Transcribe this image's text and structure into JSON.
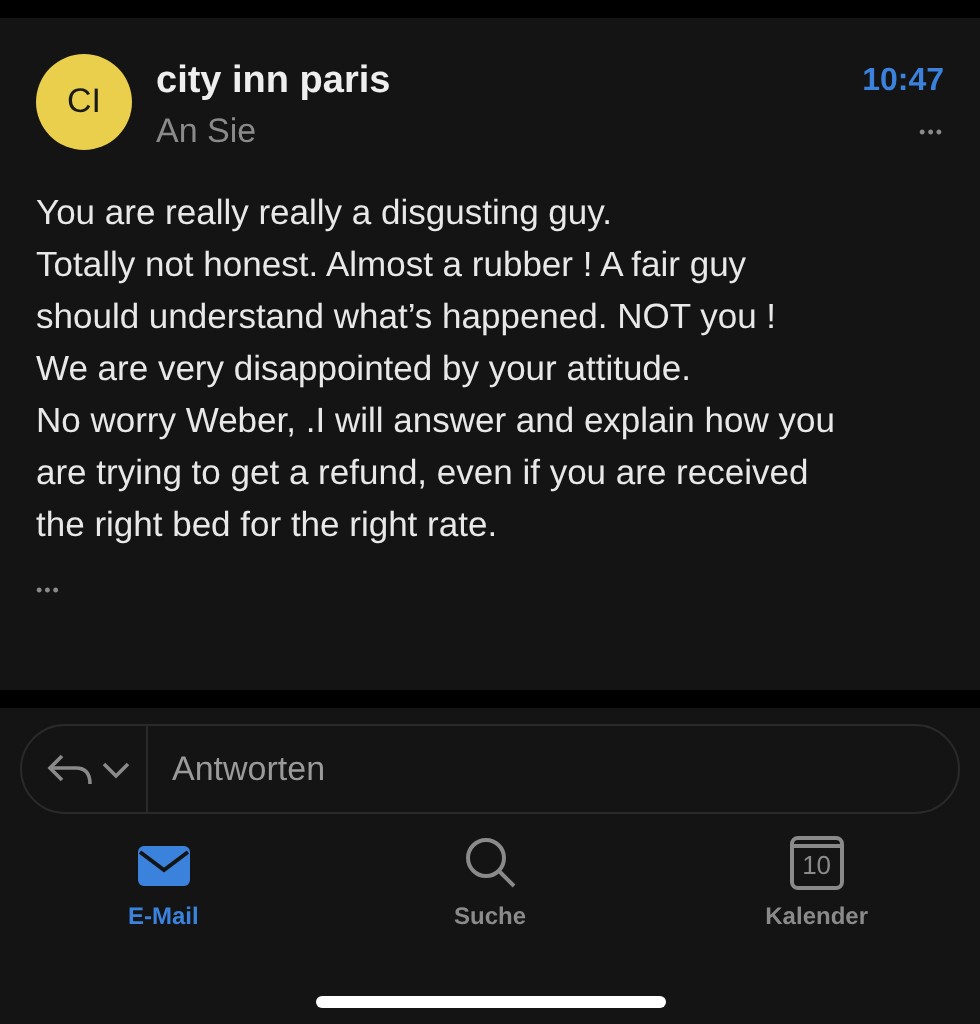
{
  "message": {
    "avatar_initials": "CI",
    "sender": "city inn paris",
    "recipient": "An Sie",
    "time": "10:47",
    "more": "•••",
    "body_lines": [
      "You are really really a disgusting guy.",
      "Totally not honest. Almost a rubber ! A fair guy",
      "should understand what’s happened. NOT you !",
      "We are very disappointed by your attitude.",
      "No worry Weber, .I will answer and explain how you",
      "are trying to get a refund, even if you are received",
      "the right bed for the right rate."
    ],
    "expand": "•••"
  },
  "reply": {
    "placeholder": "Antworten"
  },
  "tabs": [
    {
      "kind": "mail",
      "label": "E-Mail",
      "selected": true
    },
    {
      "kind": "search",
      "label": "Suche",
      "selected": false
    },
    {
      "kind": "calendar",
      "label": "Kalender",
      "icon_text": "10",
      "selected": false
    }
  ]
}
